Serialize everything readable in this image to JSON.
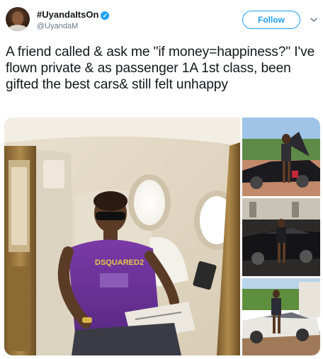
{
  "user": {
    "display_name": "#UyandaItsOn",
    "handle": "@UyandaM"
  },
  "follow_label": "Follow",
  "icons": {
    "verified": "verified-badge-icon",
    "caret": "chevron-down-icon"
  },
  "tweet": {
    "text": "A friend called & ask me \"if money=happiness?\" I've flown private & as passenger 1A 1st class, been gifted the best cars& still felt unhappy"
  },
  "photos": {
    "main_shirt_text": "DSQUARED2"
  },
  "colors": {
    "accent": "#1da1f2",
    "text": "#14171a",
    "secondary": "#657786"
  }
}
